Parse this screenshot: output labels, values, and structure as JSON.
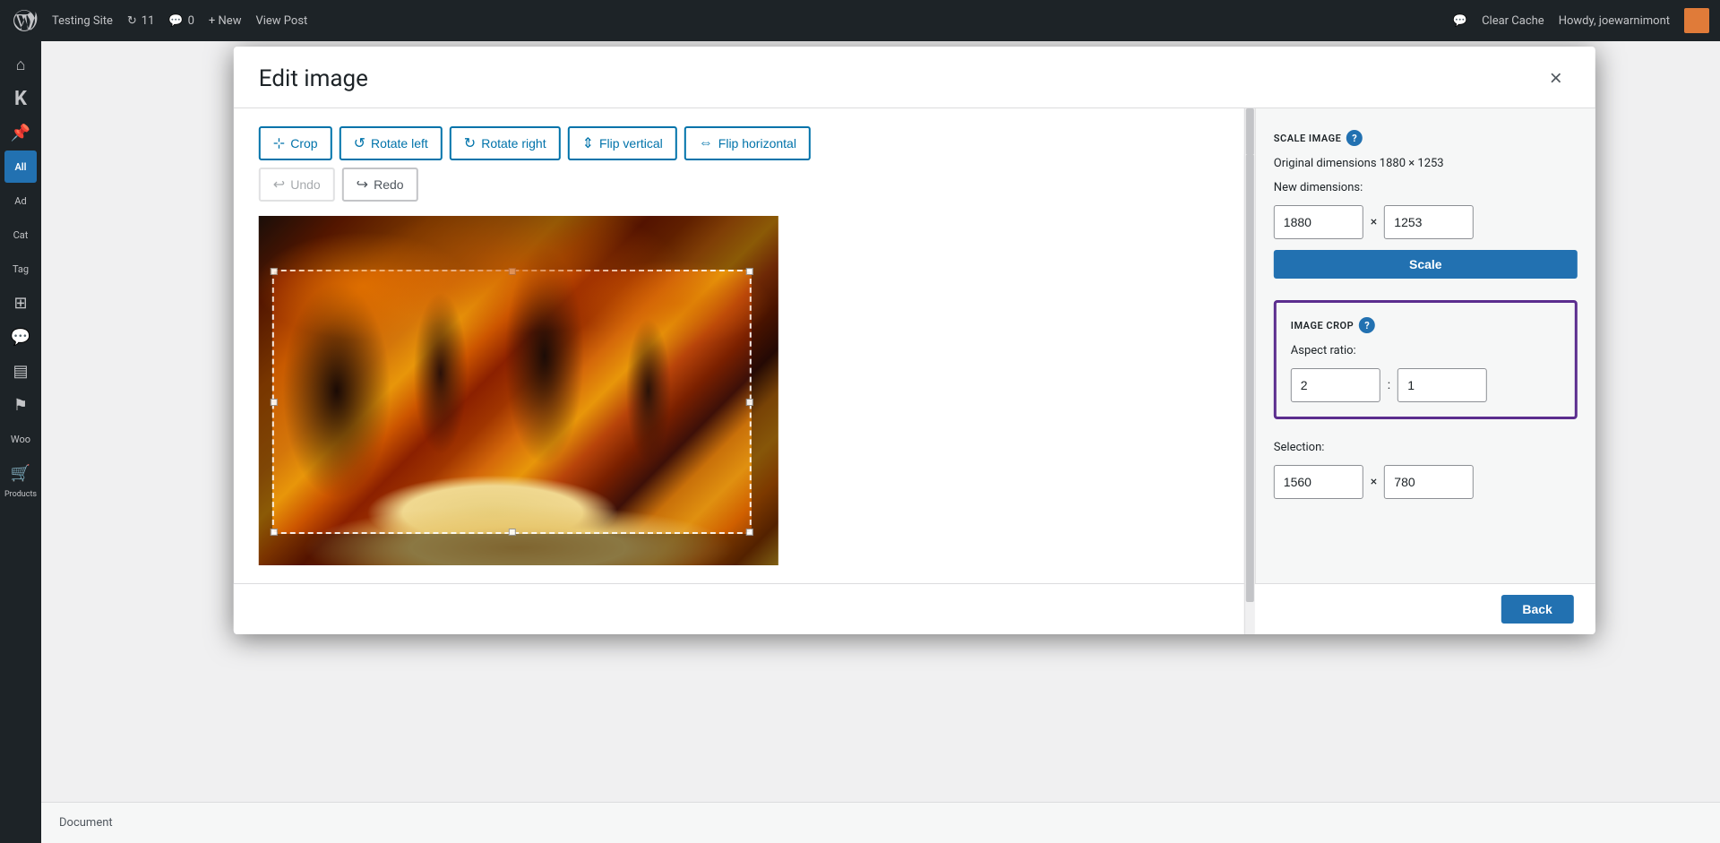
{
  "adminBar": {
    "siteName": "Testing Site",
    "updatesCount": "11",
    "commentsCount": "0",
    "newLabel": "+ New",
    "viewPost": "View Post",
    "clearCache": "Clear Cache",
    "howdy": "Howdy, joewarnimont"
  },
  "sidebar": {
    "items": [
      {
        "id": "dashboard",
        "icon": "⌂",
        "label": ""
      },
      {
        "id": "media",
        "icon": "◉",
        "label": ""
      },
      {
        "id": "paint",
        "icon": "✏",
        "label": ""
      },
      {
        "id": "all",
        "icon": "All",
        "label": ""
      },
      {
        "id": "add",
        "icon": "＋",
        "label": "Ad"
      },
      {
        "id": "cat",
        "icon": "≡",
        "label": "Cat"
      },
      {
        "id": "tag",
        "icon": "#",
        "label": "Tag"
      },
      {
        "id": "puzzle",
        "icon": "⊞",
        "label": ""
      },
      {
        "id": "chat",
        "icon": "💬",
        "label": ""
      },
      {
        "id": "layers",
        "icon": "▤",
        "label": ""
      },
      {
        "id": "flag",
        "icon": "⚑",
        "label": ""
      },
      {
        "id": "shop",
        "icon": "🛒",
        "label": "Products"
      }
    ]
  },
  "modal": {
    "title": "Edit image",
    "closeLabel": "×",
    "toolbar": {
      "cropLabel": "Crop",
      "rotateLeftLabel": "Rotate left",
      "rotateRightLabel": "Rotate right",
      "flipVerticalLabel": "Flip vertical",
      "flipHorizontalLabel": "Flip horizontal",
      "undoLabel": "Undo",
      "redoLabel": "Redo"
    },
    "settingsPanel": {
      "scaleSection": {
        "title": "SCALE IMAGE",
        "originalDimensions": "Original dimensions 1880 × 1253",
        "newDimensionsLabel": "New dimensions:",
        "widthValue": "1880",
        "heightValue": "1253",
        "separator": "×",
        "scaleButtonLabel": "Scale"
      },
      "cropSection": {
        "title": "IMAGE CROP",
        "aspectRatioLabel": "Aspect ratio:",
        "aspectWidth": "2",
        "aspectHeight": "1",
        "colonSeparator": ":",
        "selectionLabel": "Selection:",
        "selectionWidth": "1560",
        "selectionHeight": "780",
        "selectionSeparator": "×"
      }
    },
    "footer": {
      "backButtonLabel": "Back"
    }
  },
  "bottomBar": {
    "documentLabel": "Document"
  }
}
